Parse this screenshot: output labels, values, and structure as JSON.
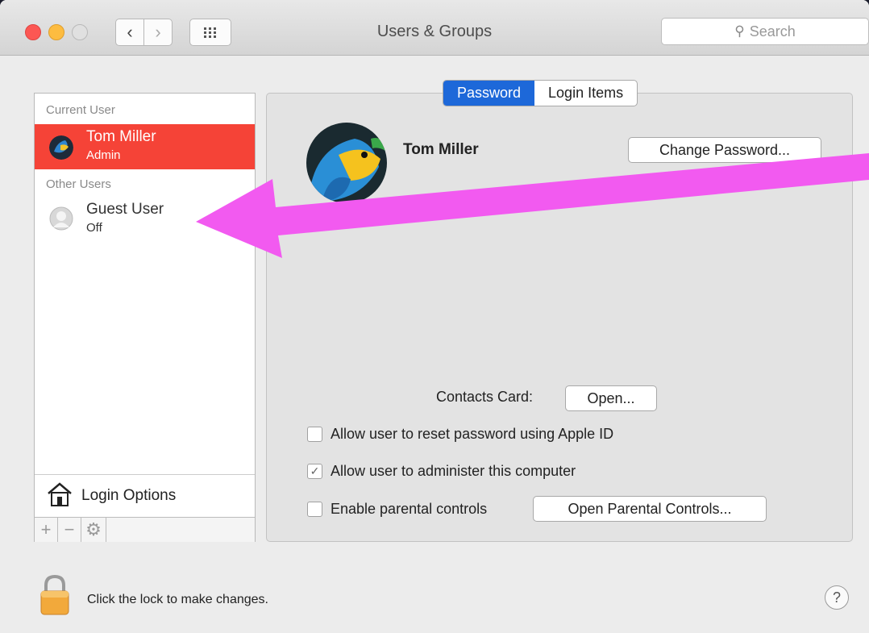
{
  "window": {
    "title": "Users & Groups"
  },
  "search": {
    "placeholder": "Search"
  },
  "tabs": [
    {
      "label": "Password",
      "active": true
    },
    {
      "label": "Login Items",
      "active": false
    }
  ],
  "sidebar": {
    "current_user_header": "Current User",
    "current_user": {
      "name": "Tom Miller",
      "role": "Admin"
    },
    "other_users_header": "Other Users",
    "other_users": [
      {
        "name": "Guest User",
        "role": "Off"
      }
    ],
    "login_options_label": "Login Options",
    "tools": {
      "add": "+",
      "remove": "−",
      "action": "⚙"
    }
  },
  "profile": {
    "name": "Tom Miller",
    "change_password_label": "Change Password...",
    "contacts_card_label": "Contacts Card:",
    "open_label": "Open...",
    "options": [
      {
        "label": "Allow user to reset password using Apple ID",
        "checked": false
      },
      {
        "label": "Allow user to administer this computer",
        "checked": true
      },
      {
        "label": "Enable parental controls",
        "checked": false
      }
    ],
    "open_parental_controls_label": "Open Parental Controls..."
  },
  "footer": {
    "lock_text": "Click the lock to make changes.",
    "help_label": "?"
  },
  "colors": {
    "selection": "#f54337",
    "tab_active": "#1d68d9",
    "annotation_arrow": "#f25af0"
  }
}
